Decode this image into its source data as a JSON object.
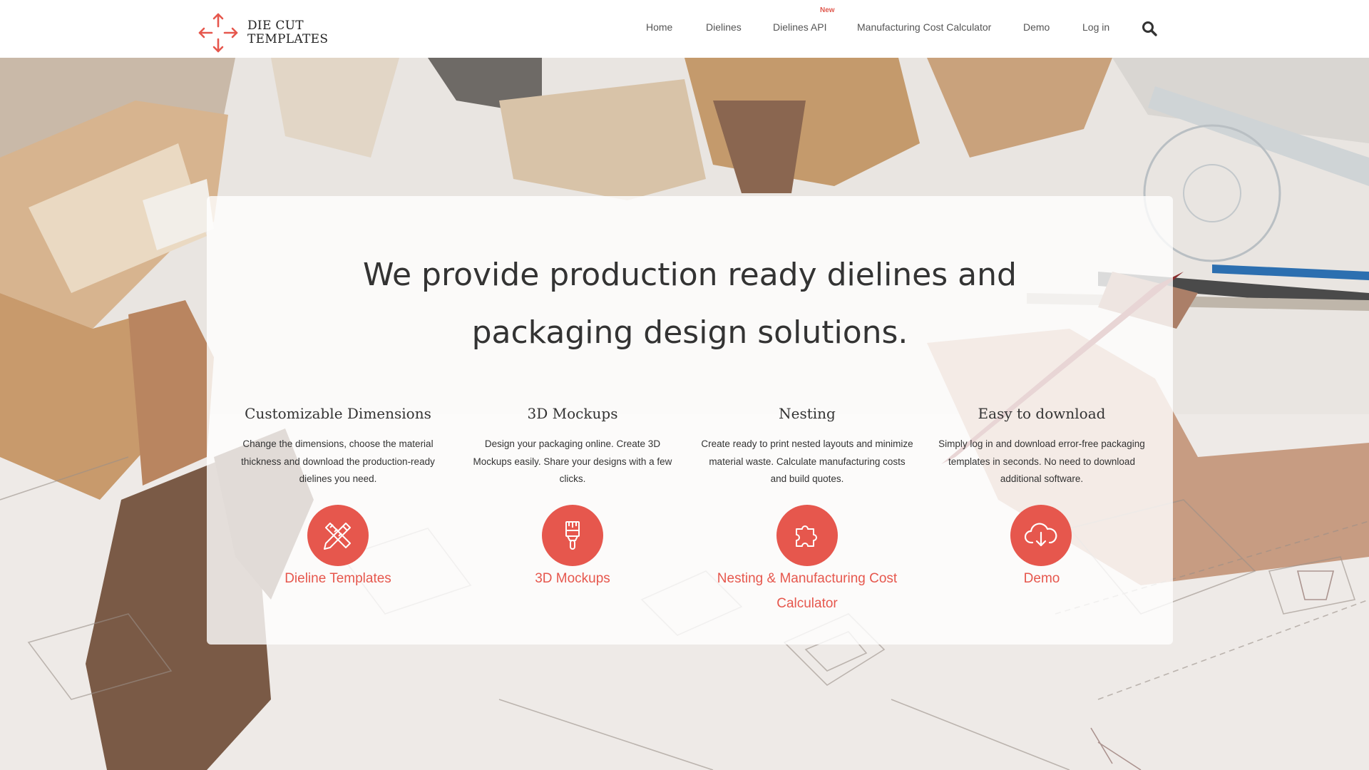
{
  "logo": {
    "line1": "DIE CUT",
    "line2": "TEMPLATES",
    "icon": "arrows-cross-icon",
    "color": "#e6574d"
  },
  "nav": {
    "items": [
      {
        "label": "Home"
      },
      {
        "label": "Dielines"
      },
      {
        "label": "Dielines API",
        "badge": "New"
      },
      {
        "label": "Manufacturing Cost Calculator"
      },
      {
        "label": "Demo"
      },
      {
        "label": "Log in"
      }
    ],
    "search_icon": "search-icon"
  },
  "hero": {
    "headline_line1": "We provide production ready dielines and",
    "headline_line2": "packaging design solutions.",
    "features": [
      {
        "title": "Customizable Dimensions",
        "description": "Change the dimensions, choose the material thickness and download the production-ready dielines you need.",
        "icon": "pencil-ruler-icon",
        "link": "Dieline Templates"
      },
      {
        "title": "3D Mockups",
        "description": "Design your packaging online. Create 3D Mockups easily. Share your designs with a few clicks.",
        "icon": "paint-brush-icon",
        "link": "3D Mockups"
      },
      {
        "title": "Nesting",
        "description": "Create ready to print nested layouts and minimize material waste. Calculate manufacturing costs and build quotes.",
        "icon": "puzzle-piece-icon",
        "link": "Nesting & Manufacturing Cost Calculator"
      },
      {
        "title": "Easy to download",
        "description": "Simply log in and download error-free packaging templates in seconds. No need to download additional software.",
        "icon": "cloud-download-icon",
        "link": "Demo"
      }
    ]
  },
  "colors": {
    "accent": "#e6574d",
    "text": "#333333",
    "nav_text": "#555555"
  }
}
